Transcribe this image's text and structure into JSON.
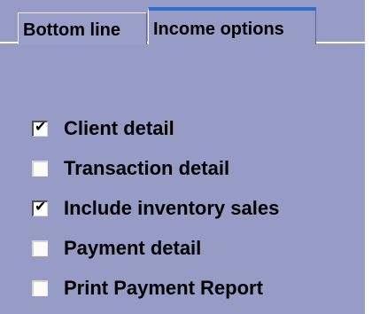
{
  "tabs": [
    {
      "label": "Bottom line",
      "active": false
    },
    {
      "label": "Income options",
      "active": true
    }
  ],
  "options": [
    {
      "label": "Client detail",
      "checked": true
    },
    {
      "label": "Transaction detail",
      "checked": false
    },
    {
      "label": "Include inventory sales",
      "checked": true
    },
    {
      "label": "Payment detail",
      "checked": false
    },
    {
      "label": "Print Payment Report",
      "checked": false
    }
  ],
  "colors": {
    "panel_background": "#969cc6",
    "active_tab_accent": "#2e6fd1"
  },
  "icons": {
    "check": "✔"
  }
}
